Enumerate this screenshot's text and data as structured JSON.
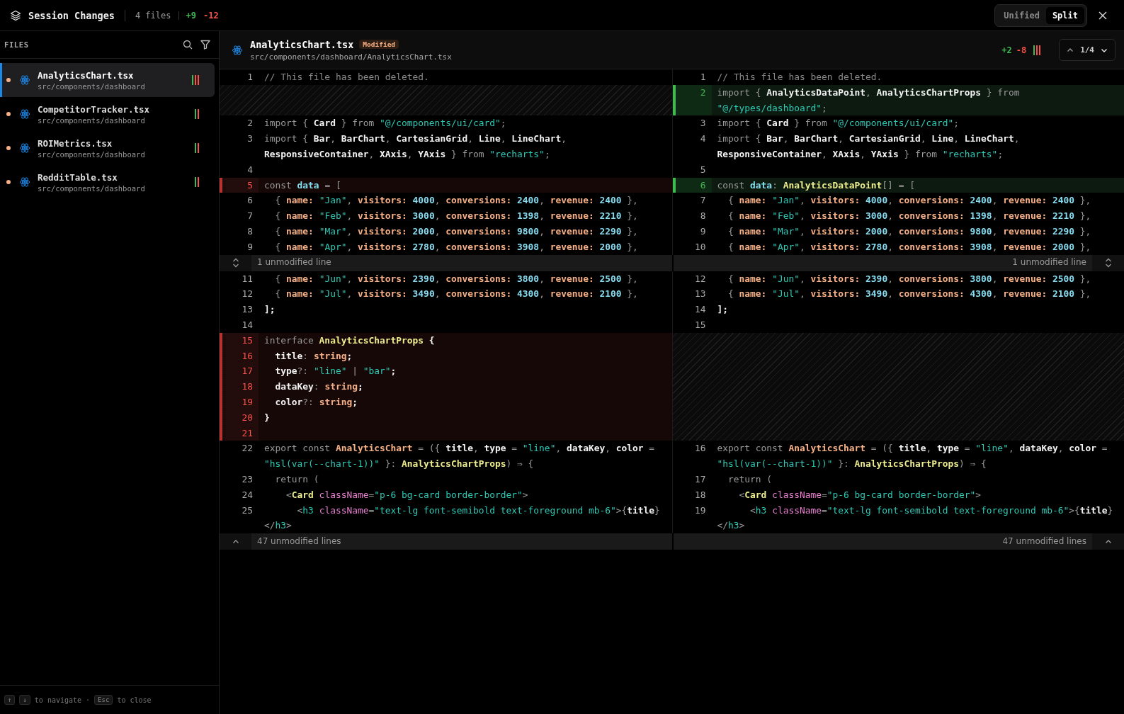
{
  "top_bar": {
    "title": "Session Changes",
    "file_count": "4 files",
    "added": "+9",
    "removed": "-12",
    "view_toggle": [
      {
        "label": "Unified",
        "selected": false
      },
      {
        "label": "Split",
        "selected": true
      }
    ]
  },
  "sidebar": {
    "heading": "FILES",
    "files": [
      {
        "name": "AnalyticsChart.tsx",
        "path": "src/components/dashboard",
        "selected": true,
        "color": "#f7b085",
        "bars": [
          {
            "kind": "added"
          },
          {
            "kind": "removed"
          },
          {
            "kind": "removed"
          }
        ]
      },
      {
        "name": "CompetitorTracker.tsx",
        "path": "src/components/dashboard",
        "selected": false,
        "color": "#f7b085",
        "bars": [
          {
            "kind": "added"
          },
          {
            "kind": "removed"
          }
        ]
      },
      {
        "name": "ROIMetrics.tsx",
        "path": "src/components/dashboard",
        "selected": false,
        "color": "#f7b085",
        "bars": [
          {
            "kind": "added"
          },
          {
            "kind": "removed"
          }
        ]
      },
      {
        "name": "RedditTable.tsx",
        "path": "src/components/dashboard",
        "selected": false,
        "color": "#f7b085",
        "bars": [
          {
            "kind": "added"
          },
          {
            "kind": "removed"
          }
        ]
      }
    ],
    "footer": [
      {
        "kind": "key",
        "text": "↑"
      },
      {
        "kind": "key",
        "text": "↓"
      },
      {
        "kind": "text",
        "text": "to navigate"
      },
      {
        "kind": "text",
        "text": "·"
      },
      {
        "kind": "key",
        "text": "Esc"
      },
      {
        "kind": "text",
        "text": "to close"
      }
    ]
  },
  "file_header": {
    "name": "AnalyticsChart.tsx",
    "badge": "Modified",
    "path": "src/components/dashboard/AnalyticsChart.tsx",
    "added": "+2",
    "removed": "-8",
    "bars": [
      {
        "kind": "added"
      },
      {
        "kind": "removed"
      },
      {
        "kind": "removed"
      }
    ],
    "position": "1/4"
  },
  "diff_rows": [
    {
      "kind": "line",
      "left": {
        "kind": "context",
        "number": "1",
        "tokens": [
          {
            "text": "// This file has been deleted.",
            "kind": "comment"
          }
        ]
      },
      "right": {
        "kind": "context",
        "number": "1",
        "tokens": [
          {
            "text": "// This file has been deleted.",
            "kind": "comment"
          }
        ]
      }
    },
    {
      "kind": "line",
      "left": {
        "kind": "empty"
      },
      "right": {
        "kind": "added",
        "number": "2",
        "tokens": [
          {
            "text": "import ",
            "kind": "keyword"
          },
          {
            "text": "{ ",
            "kind": "punct"
          },
          {
            "text": "AnalyticsDataPoint",
            "kind": "ident"
          },
          {
            "text": ", ",
            "kind": "punct"
          },
          {
            "text": "AnalyticsChartProps",
            "kind": "ident"
          },
          {
            "text": " } ",
            "kind": "punct"
          },
          {
            "text": "from ",
            "kind": "keyword"
          },
          {
            "text": "\"@/types/dashboard\"",
            "kind": "string"
          },
          {
            "text": ";",
            "kind": "punct"
          }
        ]
      }
    },
    {
      "kind": "line",
      "left": {
        "kind": "context",
        "number": "2",
        "tokens": [
          {
            "text": "import ",
            "kind": "keyword"
          },
          {
            "text": "{ ",
            "kind": "punct"
          },
          {
            "text": "Card",
            "kind": "ident"
          },
          {
            "text": " } ",
            "kind": "punct"
          },
          {
            "text": "from ",
            "kind": "keyword"
          },
          {
            "text": "\"@/components/ui/card\"",
            "kind": "string"
          },
          {
            "text": ";",
            "kind": "punct"
          }
        ]
      },
      "right": {
        "kind": "context",
        "number": "3",
        "tokens": [
          {
            "text": "import ",
            "kind": "keyword"
          },
          {
            "text": "{ ",
            "kind": "punct"
          },
          {
            "text": "Card",
            "kind": "ident"
          },
          {
            "text": " } ",
            "kind": "punct"
          },
          {
            "text": "from ",
            "kind": "keyword"
          },
          {
            "text": "\"@/components/ui/card\"",
            "kind": "string"
          },
          {
            "text": ";",
            "kind": "punct"
          }
        ]
      }
    },
    {
      "kind": "line",
      "left": {
        "kind": "context",
        "number": "3",
        "tokens": [
          {
            "text": "import ",
            "kind": "keyword"
          },
          {
            "text": "{ ",
            "kind": "punct"
          },
          {
            "text": "Bar",
            "kind": "ident"
          },
          {
            "text": ", ",
            "kind": "punct"
          },
          {
            "text": "BarChart",
            "kind": "ident"
          },
          {
            "text": ", ",
            "kind": "punct"
          },
          {
            "text": "CartesianGrid",
            "kind": "ident"
          },
          {
            "text": ", ",
            "kind": "punct"
          },
          {
            "text": "Line",
            "kind": "ident"
          },
          {
            "text": ", ",
            "kind": "punct"
          },
          {
            "text": "LineChart",
            "kind": "ident"
          },
          {
            "text": ", ",
            "kind": "punct"
          },
          {
            "text": "ResponsiveContainer",
            "kind": "ident"
          },
          {
            "text": ", ",
            "kind": "punct"
          },
          {
            "text": "XAxis",
            "kind": "ident"
          },
          {
            "text": ", ",
            "kind": "punct"
          },
          {
            "text": "YAxis",
            "kind": "ident"
          },
          {
            "text": " } ",
            "kind": "punct"
          },
          {
            "text": "from ",
            "kind": "keyword"
          },
          {
            "text": "\"recharts\"",
            "kind": "string"
          },
          {
            "text": ";",
            "kind": "punct"
          }
        ]
      },
      "right": {
        "kind": "context",
        "number": "4",
        "tokens": [
          {
            "text": "import ",
            "kind": "keyword"
          },
          {
            "text": "{ ",
            "kind": "punct"
          },
          {
            "text": "Bar",
            "kind": "ident"
          },
          {
            "text": ", ",
            "kind": "punct"
          },
          {
            "text": "BarChart",
            "kind": "ident"
          },
          {
            "text": ", ",
            "kind": "punct"
          },
          {
            "text": "CartesianGrid",
            "kind": "ident"
          },
          {
            "text": ", ",
            "kind": "punct"
          },
          {
            "text": "Line",
            "kind": "ident"
          },
          {
            "text": ", ",
            "kind": "punct"
          },
          {
            "text": "LineChart",
            "kind": "ident"
          },
          {
            "text": ", ",
            "kind": "punct"
          },
          {
            "text": "ResponsiveContainer",
            "kind": "ident"
          },
          {
            "text": ", ",
            "kind": "punct"
          },
          {
            "text": "XAxis",
            "kind": "ident"
          },
          {
            "text": ", ",
            "kind": "punct"
          },
          {
            "text": "YAxis",
            "kind": "ident"
          },
          {
            "text": " } ",
            "kind": "punct"
          },
          {
            "text": "from ",
            "kind": "keyword"
          },
          {
            "text": "\"recharts\"",
            "kind": "string"
          },
          {
            "text": ";",
            "kind": "punct"
          }
        ]
      }
    },
    {
      "kind": "line",
      "left": {
        "kind": "context",
        "number": "4"
      },
      "right": {
        "kind": "context",
        "number": "5"
      }
    },
    {
      "kind": "line",
      "left": {
        "kind": "removed",
        "number": "5",
        "tokens": [
          {
            "text": "const ",
            "kind": "keyword"
          },
          {
            "text": "data",
            "kind": "var"
          },
          {
            "text": " = [",
            "kind": "punct"
          }
        ]
      },
      "right": {
        "kind": "added",
        "number": "6",
        "tokens": [
          {
            "text": "const ",
            "kind": "keyword"
          },
          {
            "text": "data",
            "kind": "var"
          },
          {
            "text": ": ",
            "kind": "punct"
          },
          {
            "text": "AnalyticsDataPoint",
            "kind": "type"
          },
          {
            "text": "[] = [",
            "kind": "punct"
          }
        ]
      }
    },
    {
      "kind": "line",
      "left": {
        "kind": "context",
        "number": "6",
        "tokens": [
          {
            "text": "  { ",
            "kind": "punct"
          },
          {
            "text": "name: ",
            "kind": "prop"
          },
          {
            "text": "\"Jan\"",
            "kind": "string"
          },
          {
            "text": ", ",
            "kind": "punct"
          },
          {
            "text": "visitors: ",
            "kind": "prop"
          },
          {
            "text": "4000",
            "kind": "number"
          },
          {
            "text": ", ",
            "kind": "punct"
          },
          {
            "text": "conversions: ",
            "kind": "prop"
          },
          {
            "text": "2400",
            "kind": "number"
          },
          {
            "text": ", ",
            "kind": "punct"
          },
          {
            "text": "revenue: ",
            "kind": "prop"
          },
          {
            "text": "2400",
            "kind": "number"
          },
          {
            "text": " },",
            "kind": "punct"
          }
        ]
      },
      "right": {
        "kind": "context",
        "number": "7",
        "tokens": [
          {
            "text": "  { ",
            "kind": "punct"
          },
          {
            "text": "name: ",
            "kind": "prop"
          },
          {
            "text": "\"Jan\"",
            "kind": "string"
          },
          {
            "text": ", ",
            "kind": "punct"
          },
          {
            "text": "visitors: ",
            "kind": "prop"
          },
          {
            "text": "4000",
            "kind": "number"
          },
          {
            "text": ", ",
            "kind": "punct"
          },
          {
            "text": "conversions: ",
            "kind": "prop"
          },
          {
            "text": "2400",
            "kind": "number"
          },
          {
            "text": ", ",
            "kind": "punct"
          },
          {
            "text": "revenue: ",
            "kind": "prop"
          },
          {
            "text": "2400",
            "kind": "number"
          },
          {
            "text": " },",
            "kind": "punct"
          }
        ]
      }
    },
    {
      "kind": "line",
      "left": {
        "kind": "context",
        "number": "7",
        "tokens": [
          {
            "text": "  { ",
            "kind": "punct"
          },
          {
            "text": "name: ",
            "kind": "prop"
          },
          {
            "text": "\"Feb\"",
            "kind": "string"
          },
          {
            "text": ", ",
            "kind": "punct"
          },
          {
            "text": "visitors: ",
            "kind": "prop"
          },
          {
            "text": "3000",
            "kind": "number"
          },
          {
            "text": ", ",
            "kind": "punct"
          },
          {
            "text": "conversions: ",
            "kind": "prop"
          },
          {
            "text": "1398",
            "kind": "number"
          },
          {
            "text": ", ",
            "kind": "punct"
          },
          {
            "text": "revenue: ",
            "kind": "prop"
          },
          {
            "text": "2210",
            "kind": "number"
          },
          {
            "text": " },",
            "kind": "punct"
          }
        ]
      },
      "right": {
        "kind": "context",
        "number": "8",
        "tokens": [
          {
            "text": "  { ",
            "kind": "punct"
          },
          {
            "text": "name: ",
            "kind": "prop"
          },
          {
            "text": "\"Feb\"",
            "kind": "string"
          },
          {
            "text": ", ",
            "kind": "punct"
          },
          {
            "text": "visitors: ",
            "kind": "prop"
          },
          {
            "text": "3000",
            "kind": "number"
          },
          {
            "text": ", ",
            "kind": "punct"
          },
          {
            "text": "conversions: ",
            "kind": "prop"
          },
          {
            "text": "1398",
            "kind": "number"
          },
          {
            "text": ", ",
            "kind": "punct"
          },
          {
            "text": "revenue: ",
            "kind": "prop"
          },
          {
            "text": "2210",
            "kind": "number"
          },
          {
            "text": " },",
            "kind": "punct"
          }
        ]
      }
    },
    {
      "kind": "line",
      "left": {
        "kind": "context",
        "number": "8",
        "tokens": [
          {
            "text": "  { ",
            "kind": "punct"
          },
          {
            "text": "name: ",
            "kind": "prop"
          },
          {
            "text": "\"Mar\"",
            "kind": "string"
          },
          {
            "text": ", ",
            "kind": "punct"
          },
          {
            "text": "visitors: ",
            "kind": "prop"
          },
          {
            "text": "2000",
            "kind": "number"
          },
          {
            "text": ", ",
            "kind": "punct"
          },
          {
            "text": "conversions: ",
            "kind": "prop"
          },
          {
            "text": "9800",
            "kind": "number"
          },
          {
            "text": ", ",
            "kind": "punct"
          },
          {
            "text": "revenue: ",
            "kind": "prop"
          },
          {
            "text": "2290",
            "kind": "number"
          },
          {
            "text": " },",
            "kind": "punct"
          }
        ]
      },
      "right": {
        "kind": "context",
        "number": "9",
        "tokens": [
          {
            "text": "  { ",
            "kind": "punct"
          },
          {
            "text": "name: ",
            "kind": "prop"
          },
          {
            "text": "\"Mar\"",
            "kind": "string"
          },
          {
            "text": ", ",
            "kind": "punct"
          },
          {
            "text": "visitors: ",
            "kind": "prop"
          },
          {
            "text": "2000",
            "kind": "number"
          },
          {
            "text": ", ",
            "kind": "punct"
          },
          {
            "text": "conversions: ",
            "kind": "prop"
          },
          {
            "text": "9800",
            "kind": "number"
          },
          {
            "text": ", ",
            "kind": "punct"
          },
          {
            "text": "revenue: ",
            "kind": "prop"
          },
          {
            "text": "2290",
            "kind": "number"
          },
          {
            "text": " },",
            "kind": "punct"
          }
        ]
      }
    },
    {
      "kind": "line",
      "left": {
        "kind": "context",
        "number": "9",
        "tokens": [
          {
            "text": "  { ",
            "kind": "punct"
          },
          {
            "text": "name: ",
            "kind": "prop"
          },
          {
            "text": "\"Apr\"",
            "kind": "string"
          },
          {
            "text": ", ",
            "kind": "punct"
          },
          {
            "text": "visitors: ",
            "kind": "prop"
          },
          {
            "text": "2780",
            "kind": "number"
          },
          {
            "text": ", ",
            "kind": "punct"
          },
          {
            "text": "conversions: ",
            "kind": "prop"
          },
          {
            "text": "3908",
            "kind": "number"
          },
          {
            "text": ", ",
            "kind": "punct"
          },
          {
            "text": "revenue: ",
            "kind": "prop"
          },
          {
            "text": "2000",
            "kind": "number"
          },
          {
            "text": " },",
            "kind": "punct"
          }
        ]
      },
      "right": {
        "kind": "context",
        "number": "10",
        "tokens": [
          {
            "text": "  { ",
            "kind": "punct"
          },
          {
            "text": "name: ",
            "kind": "prop"
          },
          {
            "text": "\"Apr\"",
            "kind": "string"
          },
          {
            "text": ", ",
            "kind": "punct"
          },
          {
            "text": "visitors: ",
            "kind": "prop"
          },
          {
            "text": "2780",
            "kind": "number"
          },
          {
            "text": ", ",
            "kind": "punct"
          },
          {
            "text": "conversions: ",
            "kind": "prop"
          },
          {
            "text": "3908",
            "kind": "number"
          },
          {
            "text": ", ",
            "kind": "punct"
          },
          {
            "text": "revenue: ",
            "kind": "prop"
          },
          {
            "text": "2000",
            "kind": "number"
          },
          {
            "text": " },",
            "kind": "punct"
          }
        ]
      }
    },
    {
      "kind": "collapse",
      "left": "1 unmodified line",
      "right": "1 unmodified line"
    },
    {
      "kind": "line",
      "left": {
        "kind": "context",
        "number": "11",
        "tokens": [
          {
            "text": "  { ",
            "kind": "punct"
          },
          {
            "text": "name: ",
            "kind": "prop"
          },
          {
            "text": "\"Jun\"",
            "kind": "string"
          },
          {
            "text": ", ",
            "kind": "punct"
          },
          {
            "text": "visitors: ",
            "kind": "prop"
          },
          {
            "text": "2390",
            "kind": "number"
          },
          {
            "text": ", ",
            "kind": "punct"
          },
          {
            "text": "conversions: ",
            "kind": "prop"
          },
          {
            "text": "3800",
            "kind": "number"
          },
          {
            "text": ", ",
            "kind": "punct"
          },
          {
            "text": "revenue: ",
            "kind": "prop"
          },
          {
            "text": "2500",
            "kind": "number"
          },
          {
            "text": " },",
            "kind": "punct"
          }
        ]
      },
      "right": {
        "kind": "context",
        "number": "12",
        "tokens": [
          {
            "text": "  { ",
            "kind": "punct"
          },
          {
            "text": "name: ",
            "kind": "prop"
          },
          {
            "text": "\"Jun\"",
            "kind": "string"
          },
          {
            "text": ", ",
            "kind": "punct"
          },
          {
            "text": "visitors: ",
            "kind": "prop"
          },
          {
            "text": "2390",
            "kind": "number"
          },
          {
            "text": ", ",
            "kind": "punct"
          },
          {
            "text": "conversions: ",
            "kind": "prop"
          },
          {
            "text": "3800",
            "kind": "number"
          },
          {
            "text": ", ",
            "kind": "punct"
          },
          {
            "text": "revenue: ",
            "kind": "prop"
          },
          {
            "text": "2500",
            "kind": "number"
          },
          {
            "text": " },",
            "kind": "punct"
          }
        ]
      }
    },
    {
      "kind": "line",
      "left": {
        "kind": "context",
        "number": "12",
        "tokens": [
          {
            "text": "  { ",
            "kind": "punct"
          },
          {
            "text": "name: ",
            "kind": "prop"
          },
          {
            "text": "\"Jul\"",
            "kind": "string"
          },
          {
            "text": ", ",
            "kind": "punct"
          },
          {
            "text": "visitors: ",
            "kind": "prop"
          },
          {
            "text": "3490",
            "kind": "number"
          },
          {
            "text": ", ",
            "kind": "punct"
          },
          {
            "text": "conversions: ",
            "kind": "prop"
          },
          {
            "text": "4300",
            "kind": "number"
          },
          {
            "text": ", ",
            "kind": "punct"
          },
          {
            "text": "revenue: ",
            "kind": "prop"
          },
          {
            "text": "2100",
            "kind": "number"
          },
          {
            "text": " },",
            "kind": "punct"
          }
        ]
      },
      "right": {
        "kind": "context",
        "number": "13",
        "tokens": [
          {
            "text": "  { ",
            "kind": "punct"
          },
          {
            "text": "name: ",
            "kind": "prop"
          },
          {
            "text": "\"Jul\"",
            "kind": "string"
          },
          {
            "text": ", ",
            "kind": "punct"
          },
          {
            "text": "visitors: ",
            "kind": "prop"
          },
          {
            "text": "3490",
            "kind": "number"
          },
          {
            "text": ", ",
            "kind": "punct"
          },
          {
            "text": "conversions: ",
            "kind": "prop"
          },
          {
            "text": "4300",
            "kind": "number"
          },
          {
            "text": ", ",
            "kind": "punct"
          },
          {
            "text": "revenue: ",
            "kind": "prop"
          },
          {
            "text": "2100",
            "kind": "number"
          },
          {
            "text": " },",
            "kind": "punct"
          }
        ]
      }
    },
    {
      "kind": "line",
      "left": {
        "kind": "context",
        "number": "13",
        "tokens": [
          {
            "text": "];",
            "kind": "ident"
          }
        ]
      },
      "right": {
        "kind": "context",
        "number": "14",
        "tokens": [
          {
            "text": "];",
            "kind": "ident"
          }
        ]
      }
    },
    {
      "kind": "line",
      "left": {
        "kind": "context",
        "number": "14"
      },
      "right": {
        "kind": "context",
        "number": "15"
      }
    },
    {
      "kind": "line",
      "left": {
        "kind": "removed",
        "number": "15",
        "tokens": [
          {
            "text": "interface ",
            "kind": "keyword"
          },
          {
            "text": "AnalyticsChartProps",
            "kind": "type"
          },
          {
            "text": " {",
            "kind": "ident"
          }
        ]
      },
      "right": {
        "kind": "empty"
      }
    },
    {
      "kind": "line",
      "left": {
        "kind": "removed",
        "number": "16",
        "tokens": [
          {
            "text": "  title",
            "kind": "ident"
          },
          {
            "text": ": ",
            "kind": "punct"
          },
          {
            "text": "string",
            "kind": "prop"
          },
          {
            "text": ";",
            "kind": "ident"
          }
        ]
      },
      "right": {
        "kind": "empty"
      }
    },
    {
      "kind": "line",
      "left": {
        "kind": "removed",
        "number": "17",
        "tokens": [
          {
            "text": "  type",
            "kind": "ident"
          },
          {
            "text": "?: ",
            "kind": "punct"
          },
          {
            "text": "\"line\"",
            "kind": "string"
          },
          {
            "text": " | ",
            "kind": "punct"
          },
          {
            "text": "\"bar\"",
            "kind": "string"
          },
          {
            "text": ";",
            "kind": "ident"
          }
        ]
      },
      "right": {
        "kind": "empty"
      }
    },
    {
      "kind": "line",
      "left": {
        "kind": "removed",
        "number": "18",
        "tokens": [
          {
            "text": "  dataKey",
            "kind": "ident"
          },
          {
            "text": ": ",
            "kind": "punct"
          },
          {
            "text": "string",
            "kind": "prop"
          },
          {
            "text": ";",
            "kind": "ident"
          }
        ]
      },
      "right": {
        "kind": "empty"
      }
    },
    {
      "kind": "line",
      "left": {
        "kind": "removed",
        "number": "19",
        "tokens": [
          {
            "text": "  color",
            "kind": "ident"
          },
          {
            "text": "?: ",
            "kind": "punct"
          },
          {
            "text": "string",
            "kind": "prop"
          },
          {
            "text": ";",
            "kind": "ident"
          }
        ]
      },
      "right": {
        "kind": "empty"
      }
    },
    {
      "kind": "line",
      "left": {
        "kind": "removed",
        "number": "20",
        "tokens": [
          {
            "text": "}",
            "kind": "ident"
          }
        ]
      },
      "right": {
        "kind": "empty"
      }
    },
    {
      "kind": "line",
      "left": {
        "kind": "removed",
        "number": "21"
      },
      "right": {
        "kind": "empty"
      }
    },
    {
      "kind": "line",
      "left": {
        "kind": "context",
        "number": "22",
        "tokens": [
          {
            "text": "export const ",
            "kind": "keyword"
          },
          {
            "text": "AnalyticsChart",
            "kind": "func"
          },
          {
            "text": " = ({ ",
            "kind": "punct"
          },
          {
            "text": "title",
            "kind": "ident"
          },
          {
            "text": ", ",
            "kind": "punct"
          },
          {
            "text": "type",
            "kind": "ident"
          },
          {
            "text": " = ",
            "kind": "punct"
          },
          {
            "text": "\"line\"",
            "kind": "string"
          },
          {
            "text": ", ",
            "kind": "punct"
          },
          {
            "text": "dataKey",
            "kind": "ident"
          },
          {
            "text": ", ",
            "kind": "punct"
          },
          {
            "text": "color",
            "kind": "ident"
          },
          {
            "text": " = ",
            "kind": "punct"
          },
          {
            "text": "\"hsl(var(--chart-1))\"",
            "kind": "string"
          },
          {
            "text": " }: ",
            "kind": "punct"
          },
          {
            "text": "AnalyticsChartProps",
            "kind": "type"
          },
          {
            "text": ") ⇒ {",
            "kind": "punct"
          }
        ]
      },
      "right": {
        "kind": "context",
        "number": "16",
        "tokens": [
          {
            "text": "export const ",
            "kind": "keyword"
          },
          {
            "text": "AnalyticsChart",
            "kind": "func"
          },
          {
            "text": " = ({ ",
            "kind": "punct"
          },
          {
            "text": "title",
            "kind": "ident"
          },
          {
            "text": ", ",
            "kind": "punct"
          },
          {
            "text": "type",
            "kind": "ident"
          },
          {
            "text": " = ",
            "kind": "punct"
          },
          {
            "text": "\"line\"",
            "kind": "string"
          },
          {
            "text": ", ",
            "kind": "punct"
          },
          {
            "text": "dataKey",
            "kind": "ident"
          },
          {
            "text": ", ",
            "kind": "punct"
          },
          {
            "text": "color",
            "kind": "ident"
          },
          {
            "text": " = ",
            "kind": "punct"
          },
          {
            "text": "\"hsl(var(--chart-1))\"",
            "kind": "string"
          },
          {
            "text": " }: ",
            "kind": "punct"
          },
          {
            "text": "AnalyticsChartProps",
            "kind": "type"
          },
          {
            "text": ") ⇒ {",
            "kind": "punct"
          }
        ]
      }
    },
    {
      "kind": "line",
      "left": {
        "kind": "context",
        "number": "23",
        "tokens": [
          {
            "text": "  return (",
            "kind": "keyword"
          }
        ]
      },
      "right": {
        "kind": "context",
        "number": "17",
        "tokens": [
          {
            "text": "  return (",
            "kind": "keyword"
          }
        ]
      }
    },
    {
      "kind": "line",
      "left": {
        "kind": "context",
        "number": "24",
        "tokens": [
          {
            "text": "    <",
            "kind": "punct"
          },
          {
            "text": "Card",
            "kind": "type"
          },
          {
            "text": " className",
            "kind": "attr"
          },
          {
            "text": "=",
            "kind": "punct"
          },
          {
            "text": "\"p-6 bg-card border-border\"",
            "kind": "string"
          },
          {
            "text": ">",
            "kind": "punct"
          }
        ]
      },
      "right": {
        "kind": "context",
        "number": "18",
        "tokens": [
          {
            "text": "    <",
            "kind": "punct"
          },
          {
            "text": "Card",
            "kind": "type"
          },
          {
            "text": " className",
            "kind": "attr"
          },
          {
            "text": "=",
            "kind": "punct"
          },
          {
            "text": "\"p-6 bg-card border-border\"",
            "kind": "string"
          },
          {
            "text": ">",
            "kind": "punct"
          }
        ]
      }
    },
    {
      "kind": "line",
      "left": {
        "kind": "context",
        "number": "25",
        "tokens": [
          {
            "text": "      <",
            "kind": "punct"
          },
          {
            "text": "h3",
            "kind": "tag"
          },
          {
            "text": " className",
            "kind": "attr"
          },
          {
            "text": "=",
            "kind": "punct"
          },
          {
            "text": "\"text-lg font-semibold text-foreground mb-6\"",
            "kind": "string"
          },
          {
            "text": ">{",
            "kind": "punct"
          },
          {
            "text": "title",
            "kind": "ident"
          },
          {
            "text": "} ",
            "kind": "punct"
          },
          {
            "text": "</",
            "kind": "punct"
          },
          {
            "text": "h3",
            "kind": "tag"
          },
          {
            "text": ">",
            "kind": "punct"
          }
        ]
      },
      "right": {
        "kind": "context",
        "number": "19",
        "tokens": [
          {
            "text": "      <",
            "kind": "punct"
          },
          {
            "text": "h3",
            "kind": "tag"
          },
          {
            "text": " className",
            "kind": "attr"
          },
          {
            "text": "=",
            "kind": "punct"
          },
          {
            "text": "\"text-lg font-semibold text-foreground mb-6\"",
            "kind": "string"
          },
          {
            "text": ">{",
            "kind": "punct"
          },
          {
            "text": "title",
            "kind": "ident"
          },
          {
            "text": "} ",
            "kind": "punct"
          },
          {
            "text": "</",
            "kind": "punct"
          },
          {
            "text": "h3",
            "kind": "tag"
          },
          {
            "text": ">",
            "kind": "punct"
          }
        ]
      }
    },
    {
      "kind": "collapse_end",
      "left": "47 unmodified lines",
      "right": "47 unmodified lines"
    }
  ]
}
